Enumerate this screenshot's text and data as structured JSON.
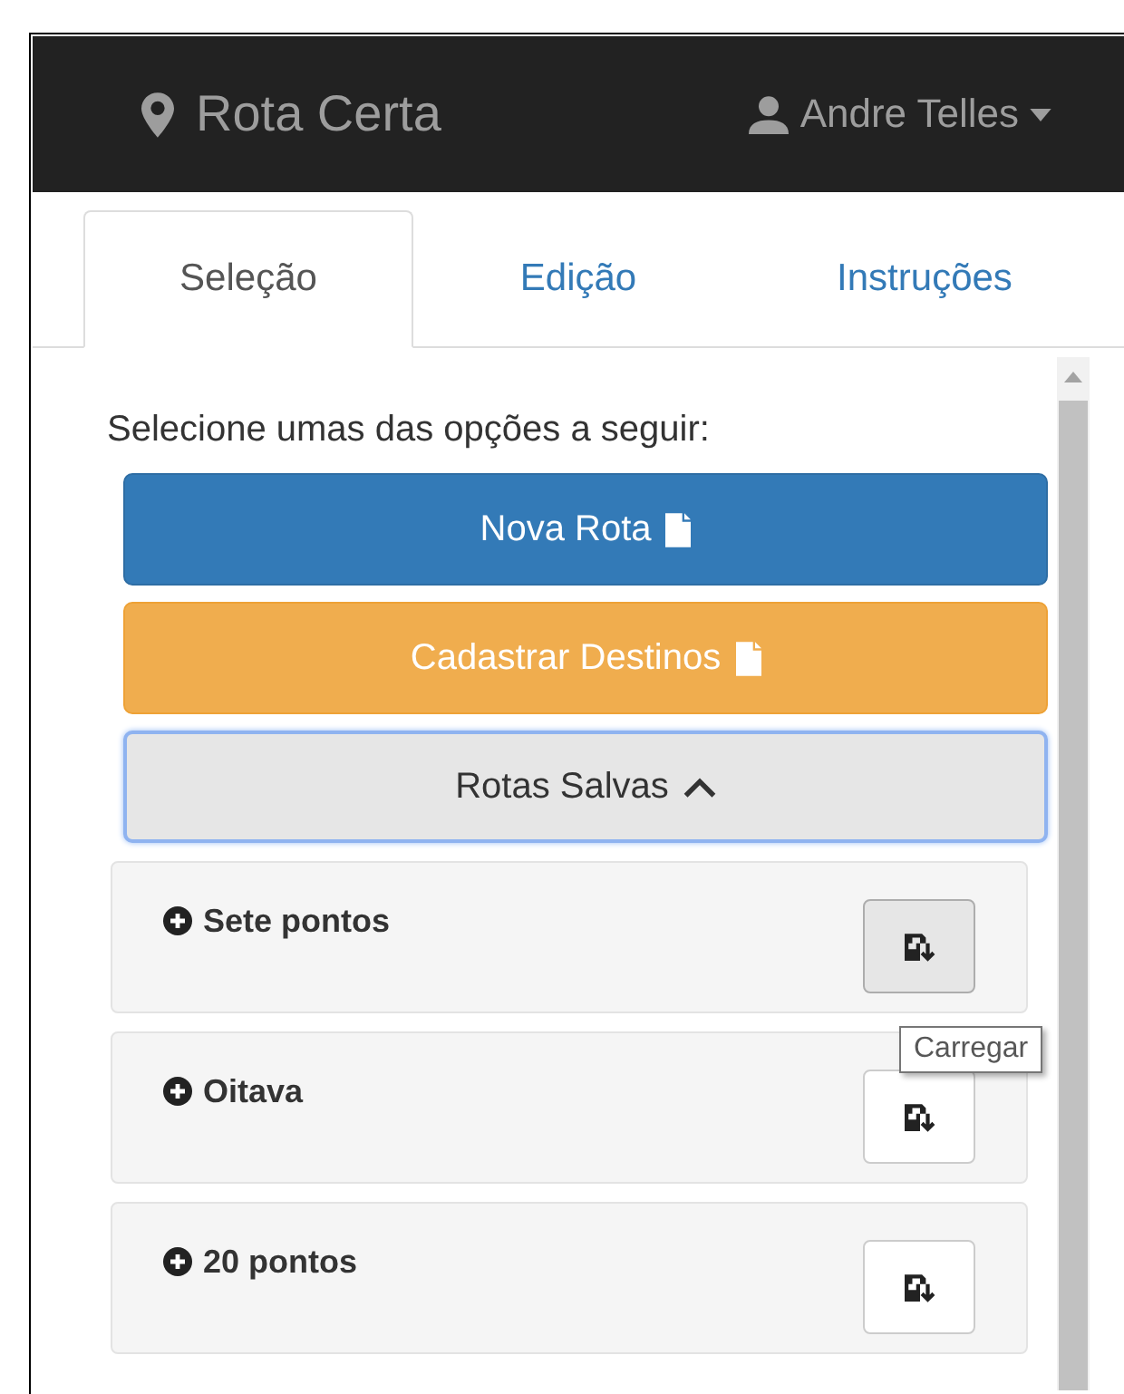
{
  "navbar": {
    "brand": "Rota Certa",
    "user": "Andre Telles"
  },
  "tabs": [
    {
      "label": "Seleção",
      "selected": true
    },
    {
      "label": "Edição",
      "selected": false
    },
    {
      "label": "Instruções",
      "selected": false
    }
  ],
  "instruction": "Selecione umas das opções a seguir:",
  "buttons": [
    {
      "kind": "primary",
      "label": "Nova Rota"
    },
    {
      "kind": "warning",
      "label": "Cadastrar Destinos"
    },
    {
      "kind": "toggle",
      "label": "Rotas Salvas",
      "expanded": true
    }
  ],
  "routes": [
    {
      "name": "Sete pontos",
      "hovered": true
    },
    {
      "name": "Oitava",
      "hovered": false
    },
    {
      "name": "20 pontos",
      "hovered": false
    }
  ],
  "tooltip": "Carregar"
}
